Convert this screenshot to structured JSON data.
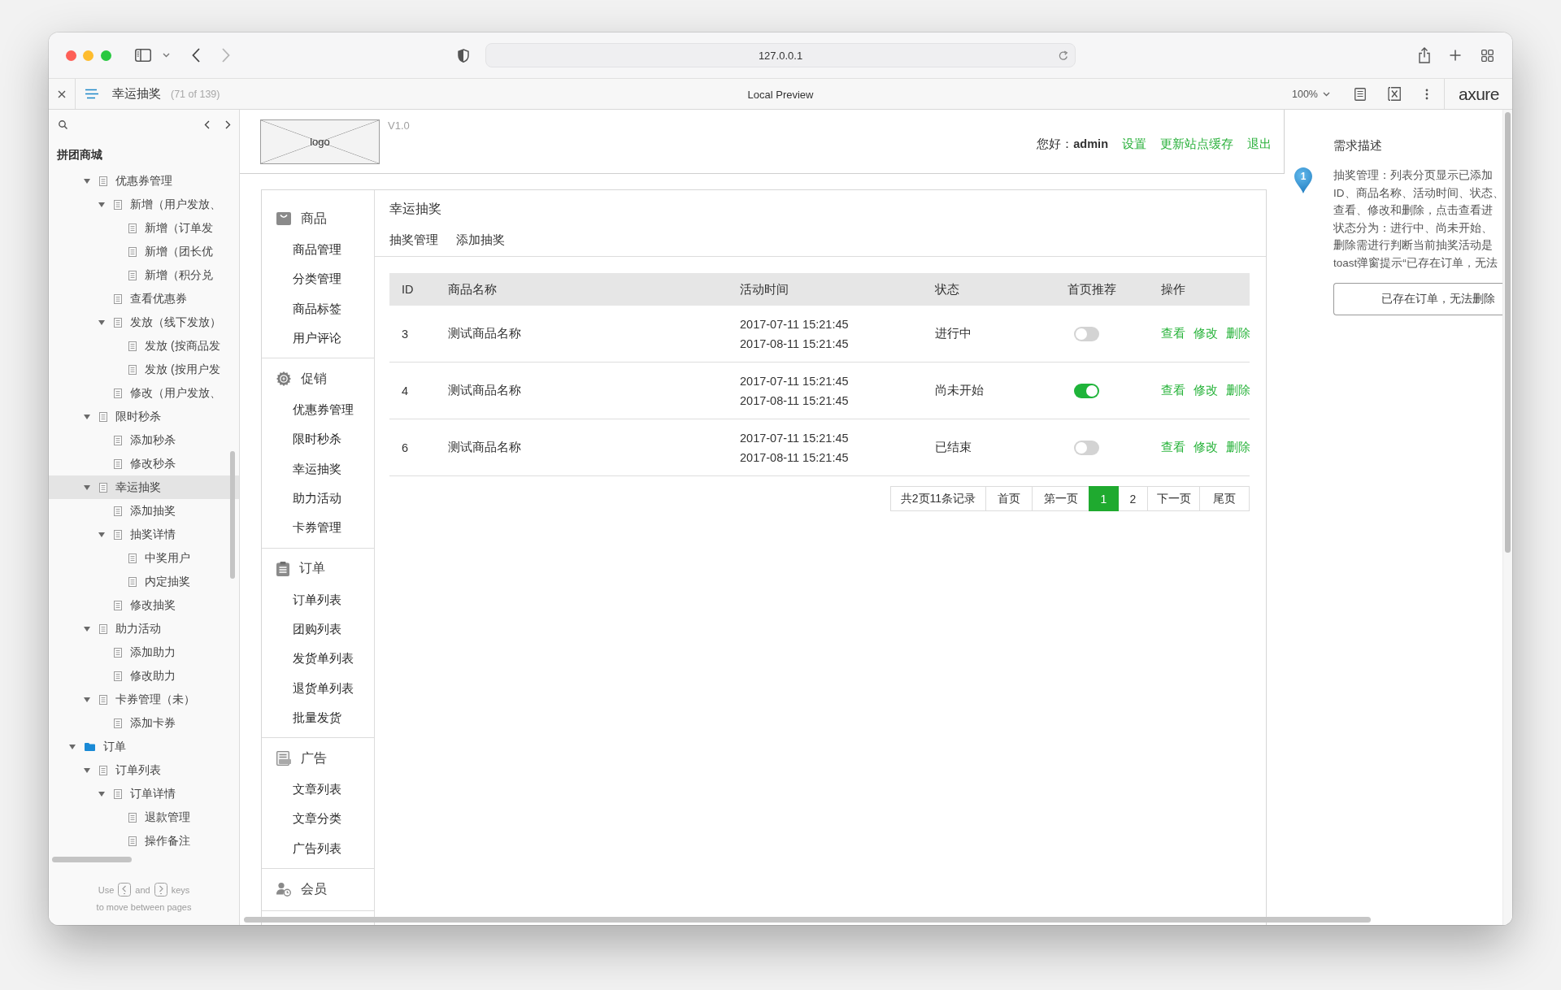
{
  "browser": {
    "address": "127.0.0.1"
  },
  "preview_bar": {
    "page_title": "幸运抽奖",
    "page_count": "(71 of 139)",
    "mode": "Local Preview",
    "zoom": "100%",
    "logo": "axure"
  },
  "sitemap": {
    "project": "拼团商城",
    "tree": [
      {
        "kind": "continued",
        "children": [
          {
            "kind": "page",
            "label": "优惠券管理",
            "selected": false,
            "expanded": true,
            "children": [
              {
                "kind": "page",
                "label": "新增（用户发放、",
                "selected": false,
                "expanded": true,
                "children": [
                  {
                    "kind": "page",
                    "label": "新增（订单发",
                    "selected": false
                  },
                  {
                    "kind": "page",
                    "label": "新增（团长优",
                    "selected": false
                  },
                  {
                    "kind": "page",
                    "label": "新增（积分兑",
                    "selected": false
                  }
                ]
              },
              {
                "kind": "page",
                "label": "查看优惠券",
                "selected": false
              },
              {
                "kind": "page",
                "label": "发放（线下发放）",
                "selected": false,
                "expanded": true,
                "children": [
                  {
                    "kind": "page",
                    "label": "发放 (按商品发",
                    "selected": false
                  },
                  {
                    "kind": "page",
                    "label": "发放 (按用户发",
                    "selected": false
                  }
                ]
              },
              {
                "kind": "page",
                "label": "修改（用户发放、",
                "selected": false
              }
            ]
          },
          {
            "kind": "page",
            "label": "限时秒杀",
            "selected": false,
            "expanded": true,
            "children": [
              {
                "kind": "page",
                "label": "添加秒杀",
                "selected": false
              },
              {
                "kind": "page",
                "label": "修改秒杀",
                "selected": false
              }
            ]
          },
          {
            "kind": "page",
            "label": "幸运抽奖",
            "selected": true,
            "expanded": true,
            "children": [
              {
                "kind": "page",
                "label": "添加抽奖",
                "selected": false
              },
              {
                "kind": "page",
                "label": "抽奖详情",
                "selected": false,
                "expanded": true,
                "children": [
                  {
                    "kind": "page",
                    "label": "中奖用户",
                    "selected": false
                  },
                  {
                    "kind": "page",
                    "label": "内定抽奖",
                    "selected": false
                  }
                ]
              },
              {
                "kind": "page",
                "label": "修改抽奖",
                "selected": false
              }
            ]
          },
          {
            "kind": "page",
            "label": "助力活动",
            "selected": false,
            "expanded": true,
            "children": [
              {
                "kind": "page",
                "label": "添加助力",
                "selected": false
              },
              {
                "kind": "page",
                "label": "修改助力",
                "selected": false
              }
            ]
          },
          {
            "kind": "page",
            "label": "卡券管理（未）",
            "selected": false,
            "expanded": true,
            "children": [
              {
                "kind": "page",
                "label": "添加卡券",
                "selected": false
              }
            ]
          }
        ]
      },
      {
        "kind": "folder",
        "label": "订单",
        "selected": false,
        "expanded": true,
        "children": [
          {
            "kind": "page",
            "label": "订单列表",
            "selected": false,
            "expanded": true,
            "children": [
              {
                "kind": "page",
                "label": "订单详情",
                "selected": false,
                "expanded": true,
                "children": [
                  {
                    "kind": "page",
                    "label": "退款管理",
                    "selected": false
                  },
                  {
                    "kind": "page",
                    "label": "操作备注",
                    "selected": false
                  }
                ]
              }
            ]
          }
        ]
      }
    ],
    "hint": {
      "words": [
        "Use",
        "and",
        "keys"
      ],
      "line_2": "to move between pages"
    }
  },
  "page": {
    "header": {
      "logo": "logo",
      "version": "V1.0",
      "greeting": "您好：**admin**",
      "links": [
        "设置",
        "更新站点缓存",
        "退出"
      ]
    },
    "nav": [
      {
        "label": "商品",
        "items": [
          "商品管理",
          "分类管理",
          "商品标签",
          "用户评论"
        ]
      },
      {
        "label": "促销",
        "items": [
          "优惠券管理",
          "限时秒杀",
          "幸运抽奖",
          "助力活动",
          "卡券管理"
        ]
      },
      {
        "label": "订单",
        "items": [
          "订单列表",
          "团购列表",
          "发货单列表",
          "退货单列表",
          "批量发货"
        ]
      },
      {
        "label": "广告",
        "items": [
          "文章列表",
          "文章分类",
          "广告列表"
        ]
      },
      {
        "label": "会员"
      }
    ],
    "content": {
      "title": "幸运抽奖",
      "links": [
        "抽奖管理",
        "添加抽奖"
      ],
      "table": {
        "columns": [
          "ID",
          "商品名称",
          "活动时间",
          "状态",
          "首页推荐",
          "操作"
        ],
        "rows": [
          {
            "id": "3",
            "name": "测试商品名称",
            "time": [
              "2017-07-11 15:21:45",
              "2017-08-11 15:21:45"
            ],
            "status": "进行中",
            "featured": false,
            "actions": [
              "查看",
              "修改",
              "删除"
            ]
          },
          {
            "id": "4",
            "name": "测试商品名称",
            "time": [
              "2017-07-11 15:21:45",
              "2017-08-11 15:21:45"
            ],
            "status": "尚未开始",
            "featured": true,
            "actions": [
              "查看",
              "修改",
              "删除"
            ]
          },
          {
            "id": "6",
            "name": "测试商品名称",
            "time": [
              "2017-07-11 15:21:45",
              "2017-08-11 15:21:45"
            ],
            "status": "已结束",
            "featured": false,
            "actions": [
              "查看",
              "修改",
              "删除"
            ]
          }
        ]
      },
      "pagination": {
        "summary": "共2页11条记录",
        "first": "首页",
        "previous": "第一页",
        "pages": [
          {
            "label": "1",
            "selected": true
          },
          {
            "label": "2",
            "selected": false
          }
        ],
        "next": "下一页",
        "last": "尾页"
      }
    }
  },
  "notes": {
    "title": "需求描述",
    "marker": "1",
    "lines": [
      "抽奖管理：列表分页显示已添加",
      "ID、商品名称、活动时间、状态、",
      "查看、修改和删除，点击查看进",
      "状态分为：进行中、尚未开始、",
      "删除需进行判断当前抽奖活动是",
      "toast弹窗提示“已存在订单，无法"
    ],
    "toast": "已存在订单，无法删除"
  }
}
